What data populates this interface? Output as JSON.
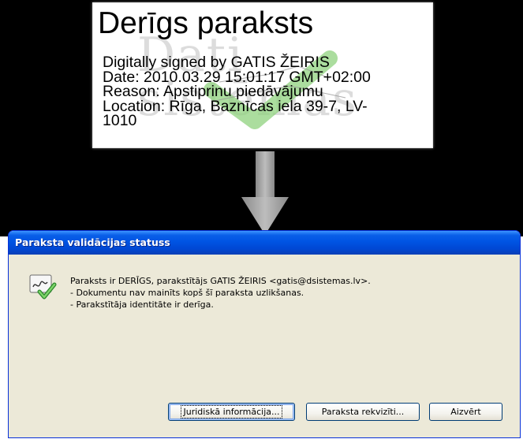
{
  "signature": {
    "title": "Derīgs paraksts",
    "watermark": "Dati\nsistēmas",
    "lines": [
      "Digitally signed by GATIS ŽEIRIS",
      "Date: 2010.03.29 15:01:17 GMT+02:00",
      "Reason: Apstiprinu piedāvājumu",
      "Location: Rīga, Baznīcas iela 39-7, LV-\n1010"
    ]
  },
  "dialog": {
    "title": "Paraksta validācijas statuss",
    "message": [
      "Paraksts ir DERĪGS, parakstītājs GATIS ŽEIRIS <gatis@dsistemas.lv>.",
      "- Dokumentu nav mainīts kopš šī paraksta uzlikšanas.",
      "- Parakstītāja identitāte ir derīga."
    ],
    "buttons": {
      "legal": "Juridiskā informācija...",
      "details": "Paraksta rekvizīti...",
      "close": "Aizvērt"
    }
  },
  "icons": {
    "arrow": "down-arrow-icon",
    "signature_status": "valid-signature-icon",
    "card_check": "checkmark-icon"
  },
  "colors": {
    "titlebar": "#0054e3",
    "dialog_bg": "#ece9d8",
    "check_green": "#5bb84a"
  }
}
